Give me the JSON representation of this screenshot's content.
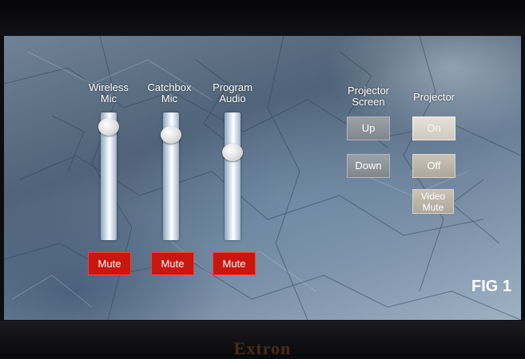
{
  "brand": "Extron",
  "audio": {
    "channels": [
      {
        "label_line1": "Wireless",
        "label_line2": "Mic",
        "level": 0.95,
        "mute_label": "Mute"
      },
      {
        "label_line1": "Catchbox",
        "label_line2": "Mic",
        "level": 0.88,
        "mute_label": "Mute"
      },
      {
        "label_line1": "Program",
        "label_line2": "Audio",
        "level": 0.72,
        "mute_label": "Mute"
      }
    ]
  },
  "projector_screen": {
    "title_line1": "Projector",
    "title_line2": "Screen",
    "up_label": "Up",
    "down_label": "Down"
  },
  "projector": {
    "title": "Projector",
    "on_label": "On",
    "off_label": "Off",
    "video_mute_line1": "Video",
    "video_mute_line2": "Mute"
  },
  "caption": "FIG 1",
  "colors": {
    "mute_red": "#c8170f",
    "button_gray": "#8d949a",
    "background_blue": "#5a6f85"
  }
}
